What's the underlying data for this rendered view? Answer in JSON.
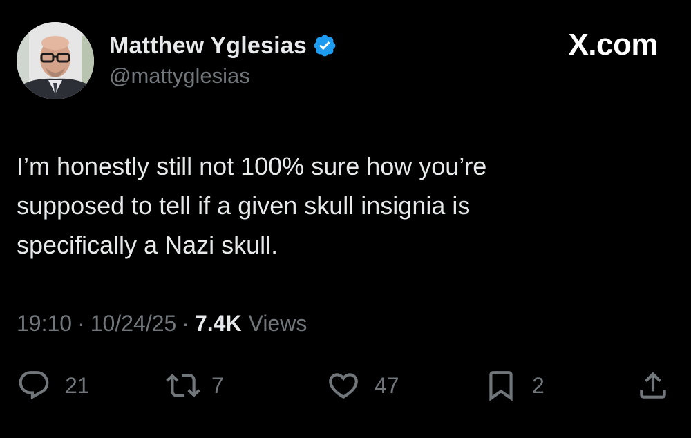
{
  "author": {
    "display_name": "Matthew Yglesias",
    "handle": "@mattyglesias",
    "verified": true
  },
  "site_logo": "X.com",
  "tweet": {
    "text_lines": [
      "I’m honestly still not 100% sure how you’re",
      "supposed to tell if a given skull insignia is",
      "specifically a Nazi skull."
    ]
  },
  "meta": {
    "time": "19:10",
    "separator": "·",
    "date": "10/24/25",
    "views_count": "7.4K",
    "views_label": "Views"
  },
  "actions": {
    "replies": "21",
    "reposts": "7",
    "likes": "47",
    "bookmarks": "2"
  },
  "colors": {
    "background": "#000000",
    "primary_text": "#e7e9ea",
    "secondary_text": "#71767b",
    "verified_badge": "#1d9bf0"
  },
  "icons": {
    "verified": "verified-badge-icon",
    "reply": "reply-icon",
    "repost": "repost-icon",
    "like": "heart-icon",
    "bookmark": "bookmark-icon",
    "share": "share-icon"
  }
}
